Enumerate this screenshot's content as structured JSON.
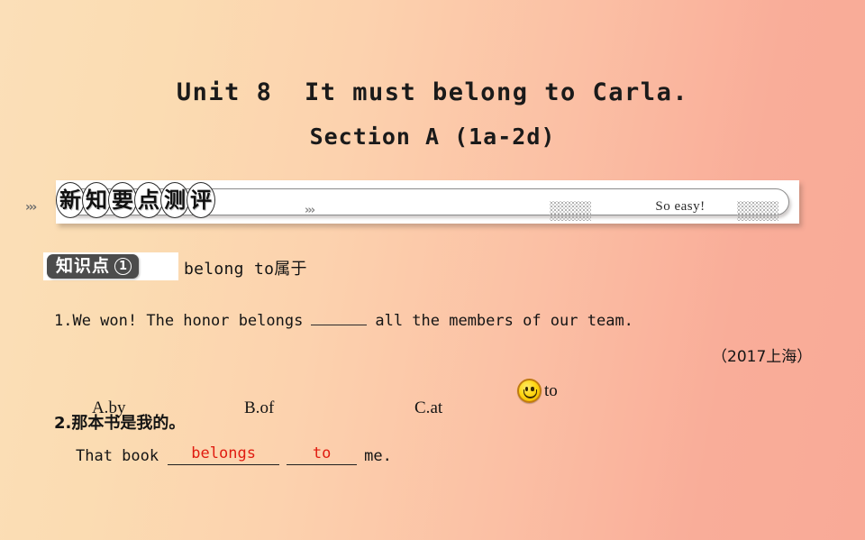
{
  "slide": {
    "title_line_1": "Unit 8  It must belong to Carla.",
    "title_line_2": "Section A (1a-2d)",
    "background_left": "#fbdfb8",
    "background_right": "#f9aa97"
  },
  "banner": {
    "chevrons_left": "›››",
    "chevrons_right": "›››",
    "characters": [
      "新",
      "知",
      "要",
      "点",
      "测",
      "评"
    ],
    "tagline": "So easy!",
    "dot_pattern_left": "dot-grid",
    "dot_pattern_right": "dot-grid"
  },
  "knowledge_point": {
    "badge_text": "知识点",
    "badge_number": "1",
    "label": "belong to属于"
  },
  "question_1": {
    "number_and_text_before": "1.We won! The honor belongs",
    "text_after": "all the members of our team.",
    "source": "（2017上海）",
    "options": [
      {
        "key": "A.",
        "text": "by",
        "correct": false
      },
      {
        "key": "B.",
        "text": "of",
        "correct": false
      },
      {
        "key": "C.",
        "text": "at",
        "correct": false
      },
      {
        "key": "",
        "text": "to",
        "correct": true,
        "marker_icon": "smiley-face-icon"
      }
    ]
  },
  "question_2": {
    "prompt_cn": "2.那本书是我的。",
    "text_start": "That book",
    "answer_1": "belongs",
    "answer_2": "to",
    "text_end": "me.",
    "answer_color": "#e01b10"
  }
}
